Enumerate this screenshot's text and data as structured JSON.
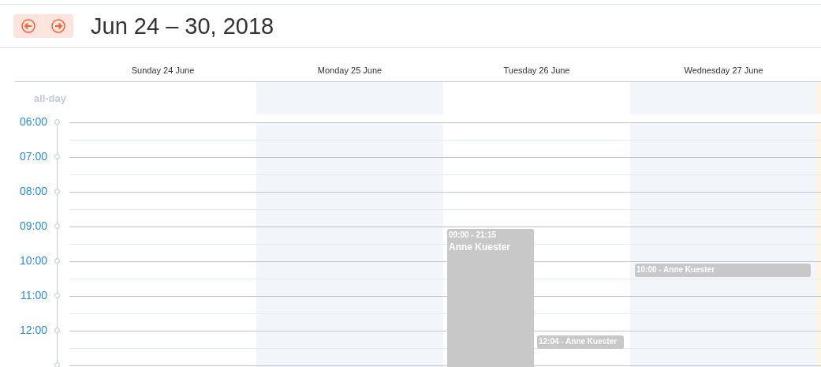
{
  "toolbar": {
    "title": "Jun 24 – 30, 2018"
  },
  "all_day_label": "all-day",
  "hours": [
    "06:00",
    "07:00",
    "08:00",
    "09:00",
    "10:00",
    "11:00",
    "12:00"
  ],
  "days": [
    {
      "label": "Sunday 24 June",
      "shaded": false,
      "today": false
    },
    {
      "label": "Monday 25 June",
      "shaded": true,
      "today": false
    },
    {
      "label": "Tuesday 26 June",
      "shaded": false,
      "today": false,
      "events": [
        {
          "kind": "block",
          "time": "09:00 - 21:15",
          "title": "Anne Kuester"
        },
        {
          "kind": "bar",
          "text": "12:04 - Anne Kuester"
        }
      ]
    },
    {
      "label": "Wednesday 27 June",
      "shaded": true,
      "today": false,
      "events": [
        {
          "kind": "bar",
          "text": "10:00 - Anne Kuester"
        }
      ]
    },
    {
      "today": true,
      "shaded": false
    }
  ]
}
